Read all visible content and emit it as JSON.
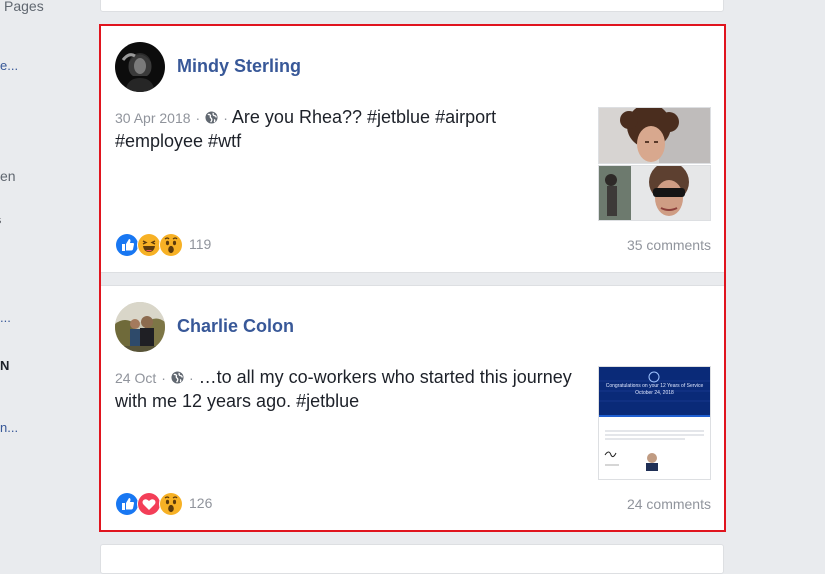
{
  "left_sidebar": {
    "items": [
      {
        "text": "Pages"
      },
      {
        "text": "e..."
      },
      {
        "text": "en"
      },
      {
        "text": "s"
      },
      {
        "text": "..."
      },
      {
        "text": "N"
      },
      {
        "text": "n..."
      }
    ]
  },
  "posts": [
    {
      "author": "Mindy Sterling",
      "date": "30 Apr 2018",
      "separator": "·",
      "text": "Are you Rhea?? #jetblue #airport #employee #wtf",
      "privacy_icon": "globe-icon",
      "reaction_icons": [
        "like-icon",
        "haha-icon",
        "wow-icon"
      ],
      "reaction_count": "119",
      "comments": "35 comments"
    },
    {
      "author": "Charlie Colon",
      "date": "24 Oct",
      "separator": "·",
      "text": "…to all my co-workers who started this journey with me 12 years ago. #jetblue",
      "privacy_icon": "globe-icon",
      "reaction_icons": [
        "like-icon",
        "love-icon",
        "wow-icon"
      ],
      "reaction_count": "126",
      "comments": "24 comments",
      "certificate": {
        "title": "Congratulations on your 12 Years of Service",
        "date": "October 24, 2018"
      }
    }
  ],
  "colors": {
    "link": "#385898",
    "highlight_border": "#e0141e",
    "meta": "#90949c",
    "like": "#1877f2",
    "love": "#f33e58",
    "wow": "#f7b125"
  }
}
